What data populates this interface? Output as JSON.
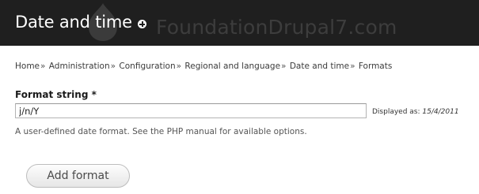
{
  "header": {
    "title": "Date and time",
    "shortcut_icon": "plus-circle-icon",
    "watermark": "FoundationDrupal7.com",
    "background": "#1f1f1f"
  },
  "breadcrumb": {
    "items": [
      "Home",
      "Administration",
      "Configuration",
      "Regional and language",
      "Date and time",
      "Formats"
    ],
    "separator": "»"
  },
  "form": {
    "format_label": "Format string *",
    "format_value": "j/n/Y",
    "preview_label": "Displayed as:",
    "preview_value": "15/4/2011",
    "description": "A user-defined date format. See the PHP manual for available options.",
    "submit_label": "Add format"
  }
}
